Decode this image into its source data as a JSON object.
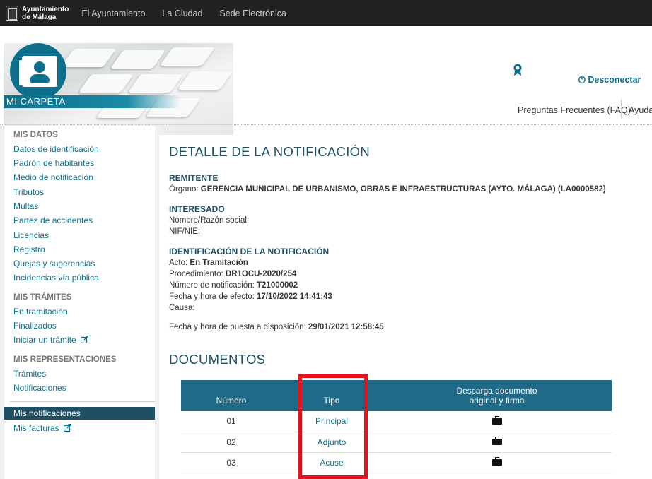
{
  "topbar": {
    "logo_line1": "Ayuntamiento",
    "logo_line2": "de Málaga",
    "nav": [
      "El Ayuntamiento",
      "La Ciudad",
      "Sede Electrónica"
    ]
  },
  "header": {
    "carpeta_label": "MI CARPETA",
    "logout_label": "Desconectar",
    "faq_label": "Preguntas Frecuentes (FAQ)",
    "help_label": "Ayuda"
  },
  "sidebar": {
    "mis_datos": {
      "heading": "MIS DATOS",
      "items": [
        "Datos de identificación",
        "Padrón de habitantes",
        "Medio de notificación",
        "Tributos",
        "Multas",
        "Partes de accidentes",
        "Licencias",
        "Registro",
        "Quejas y sugerencias",
        "Incidencias vía pública"
      ]
    },
    "mis_tramites": {
      "heading": "MIS TRÁMITES",
      "items": [
        "En tramitación",
        "Finalizados",
        "Iniciar un trámite"
      ]
    },
    "mis_representaciones": {
      "heading": "MIS REPRESENTACIONES",
      "items": [
        "Trámites",
        "Notificaciones"
      ]
    },
    "active_item": "Mis notificaciones",
    "mis_facturas": "Mis facturas"
  },
  "main": {
    "title": "DETALLE DE LA NOTIFICACIÓN",
    "remitente": {
      "heading": "REMITENTE",
      "organo_label": "Órgano:",
      "organo_value": "GERENCIA MUNICIPAL DE URBANISMO, OBRAS E INFRAESTRUCTURAS (AYTO. MÁLAGA) (LA0000582)"
    },
    "interesado": {
      "heading": "INTERESADO",
      "nombre_label": "Nombre/Razón social:",
      "nif_label": "NIF/NIE:"
    },
    "identificacion": {
      "heading": "IDENTIFICACIÓN DE LA NOTIFICACIÓN",
      "acto_label": "Acto:",
      "acto_value": "En Tramitación",
      "procedimiento_label": "Procedimiento:",
      "procedimiento_value": "DR1OCU-2020/254",
      "numero_label": "Número de notificación:",
      "numero_value": "T21000002",
      "fecha_efecto_label": "Fecha y hora de efecto:",
      "fecha_efecto_value": "17/10/2022 14:41:43",
      "causa_label": "Causa:",
      "puesta_label": "Fecha y hora de puesta a disposición:",
      "puesta_value": "29/01/2021 12:58:45"
    },
    "documentos": {
      "heading": "DOCUMENTOS",
      "columns": [
        "Número",
        "Tipo",
        "Descarga documento",
        "original y firma"
      ],
      "rows": [
        {
          "numero": "01",
          "tipo": "Principal"
        },
        {
          "numero": "02",
          "tipo": "Adjunto"
        },
        {
          "numero": "03",
          "tipo": "Acuse"
        }
      ]
    }
  },
  "colors": {
    "accent": "#0e6f8a",
    "table_header": "#1f6a88",
    "active_sidebar": "#1f4f63",
    "highlight_box": "#e8101a"
  }
}
